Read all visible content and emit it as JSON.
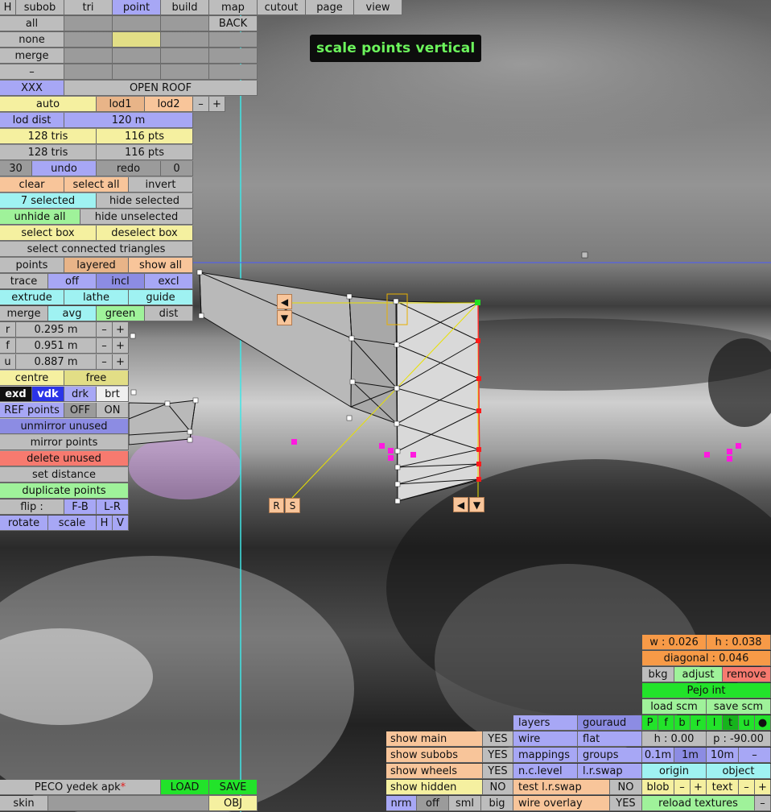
{
  "topmenu": {
    "items": [
      "H",
      "subob",
      "tri",
      "point",
      "build",
      "map",
      "cutout",
      "page",
      "view"
    ]
  },
  "left_panel": {
    "all": "all",
    "back": "BACK",
    "none": "none",
    "merge": "merge",
    "dash": "–",
    "xxx": "XXX",
    "open_roof": "OPEN ROOF",
    "auto": "auto",
    "lod1": "lod1",
    "lod2": "lod2",
    "minus": "–",
    "plus": "+",
    "lod_dist": "lod dist",
    "lod_dist_val": "120 m",
    "tris_a": "128 tris",
    "pts_a": "116 pts",
    "tris_b": "128 tris",
    "pts_b": "116 pts",
    "undo_count": "30",
    "undo": "undo",
    "redo": "redo",
    "redo_count": "0",
    "clear": "clear",
    "select_all": "select all",
    "invert": "invert",
    "selected": "7 selected",
    "hide_selected": "hide selected",
    "unhide_all": "unhide all",
    "hide_unselected": "hide unselected",
    "select_box": "select box",
    "deselect_box": "deselect box",
    "select_connected": "select connected triangles",
    "points": "points",
    "layered": "layered",
    "show_all": "show all",
    "trace": "trace",
    "off": "off",
    "incl": "incl",
    "excl": "excl",
    "extrude": "extrude",
    "lathe": "lathe",
    "guide": "guide",
    "merge2": "merge",
    "avg": "avg",
    "green": "green",
    "dist": "dist",
    "r": "r",
    "r_val": "0.295 m",
    "f": "f",
    "f_val": "0.951 m",
    "u": "u",
    "u_val": "0.887 m",
    "centre": "centre",
    "free": "free",
    "exd": "exd",
    "vdk": "vdk",
    "drk": "drk",
    "brt": "brt",
    "ref_points": "REF points",
    "ref_off": "OFF",
    "ref_on": "ON",
    "unmirror": "unmirror unused",
    "mirror": "mirror points",
    "delete_unused": "delete unused",
    "set_distance": "set distance",
    "duplicate": "duplicate points",
    "flip": "flip :",
    "fb": "F-B",
    "lr": "L-R",
    "rotate": "rotate",
    "scale": "scale",
    "h": "H",
    "v": "V"
  },
  "status_tag": "scale points vertical",
  "handles": {
    "left": "◀",
    "down": "▼",
    "r": "R",
    "s": "S"
  },
  "bottom_left": {
    "file": "PECO yedek apk",
    "star": "*",
    "load": "LOAD",
    "save": "SAVE",
    "skin": "skin",
    "obj": "OBJ"
  },
  "bottom_mid": {
    "show_main": "show main",
    "show_main_v": "YES",
    "show_subobs": "show subobs",
    "show_subobs_v": "YES",
    "show_wheels": "show wheels",
    "show_wheels_v": "YES",
    "show_hidden": "show hidden",
    "show_hidden_v": "NO",
    "nrm": "nrm",
    "off": "off",
    "sml": "sml",
    "big": "big",
    "layers": "layers",
    "gouraud": "gouraud",
    "wire": "wire",
    "flat": "flat",
    "mappings": "mappings",
    "groups": "groups",
    "nclevel": "n.c.level",
    "lrswap": "l.r.swap",
    "test_lrswap": "test l.r.swap",
    "test_lrswap_v": "NO",
    "wire_overlay": "wire overlay",
    "wire_overlay_v": "YES"
  },
  "bottom_right": {
    "w": "w : 0.026",
    "h": "h : 0.038",
    "diagonal": "diagonal : 0.046",
    "bkg": "bkg",
    "adjust": "adjust",
    "remove": "remove",
    "pejo": "Pejo int",
    "load_scm": "load scm",
    "save_scm": "save scm",
    "letters": [
      "P",
      "f",
      "b",
      "r",
      "l",
      "t",
      "u",
      "●"
    ],
    "h0": "h : 0.00",
    "p90": "p : -90.00",
    "m01": "0.1m",
    "m1": "1m",
    "m10": "10m",
    "dash": "–",
    "origin": "origin",
    "object": "object",
    "blob": "blob",
    "minus": "–",
    "plus": "+",
    "text": "text",
    "reload": "reload textures",
    "minus2": "–"
  }
}
